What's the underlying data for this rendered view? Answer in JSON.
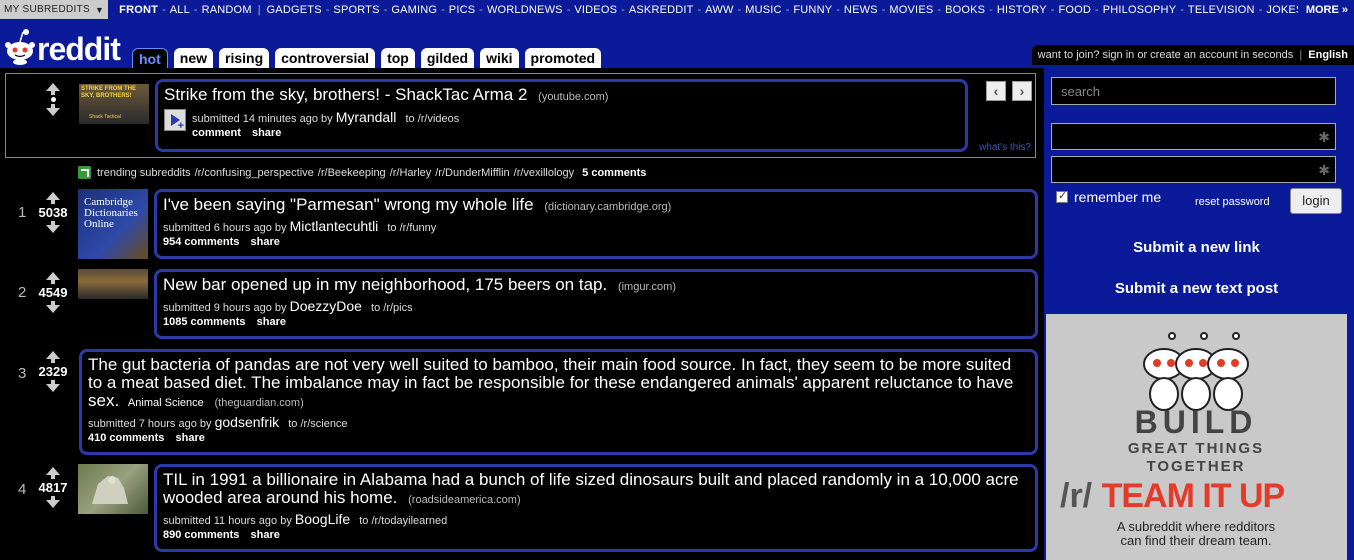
{
  "srbar": {
    "my_subreddits": "MY SUBREDDITS",
    "front": "FRONT",
    "all": "ALL",
    "random": "RANDOM",
    "links": [
      "GADGETS",
      "SPORTS",
      "GAMING",
      "PICS",
      "WORLDNEWS",
      "VIDEOS",
      "ASKREDDIT",
      "AWW",
      "MUSIC",
      "FUNNY",
      "NEWS",
      "MOVIES",
      "BOOKS",
      "HISTORY",
      "FOOD",
      "PHILOSOPHY",
      "TELEVISION",
      "JOKES"
    ],
    "more": "MORE »"
  },
  "header": {
    "logo_text": "reddit",
    "tabs": [
      "hot",
      "new",
      "rising",
      "controversial",
      "top",
      "gilded",
      "wiki",
      "promoted"
    ],
    "active_tab": "hot",
    "userbar_text": "want to join? sign in or create an account in seconds",
    "userbar_sep": "|",
    "language": "English"
  },
  "spotlight": {
    "title": "Strike from the sky, brothers! - ShackTac Arma 2",
    "domain": "(youtube.com)",
    "submitted": "submitted 14 minutes ago by",
    "author": "Myrandall",
    "to": "to /r/videos",
    "comment": "comment",
    "share": "share",
    "thumb_text1": "STRIKE FROM THE",
    "thumb_text2": "SKY, BROTHERS!",
    "thumb_text3": "Shack Tactical",
    "prev": "‹",
    "next": "›",
    "whats_this": "what's this?"
  },
  "trending": {
    "label": "trending subreddits",
    "subs": [
      "/r/confusing_perspective",
      "/r/Beekeeping",
      "/r/Harley",
      "/r/DunderMifflin",
      "/r/vexillology"
    ],
    "comments": "5 comments"
  },
  "posts": [
    {
      "rank": "1",
      "score": "5038",
      "title": "I've been saying \"Parmesan\" wrong my whole life",
      "domain": "(dictionary.cambridge.org)",
      "submitted": "submitted 6 hours ago by",
      "author": "Mictlantecuhtli",
      "to": "to /r/funny",
      "comments": "954 comments",
      "share": "share",
      "thumb_lines": [
        "Cambridge",
        "Dictionaries",
        "Online"
      ]
    },
    {
      "rank": "2",
      "score": "4549",
      "title": "New bar opened up in my neighborhood, 175 beers on tap.",
      "domain": "(imgur.com)",
      "submitted": "submitted 9 hours ago by",
      "author": "DoezzyDoe",
      "to": "to /r/pics",
      "comments": "1085 comments",
      "share": "share"
    },
    {
      "rank": "3",
      "score": "2329",
      "title": "The gut bacteria of pandas are not very well suited to bamboo, their main food source. In fact, they seem to be more suited to a meat based diet. The imbalance may in fact be responsible for these endangered animals' apparent reluctance to have sex.",
      "flair": "Animal Science",
      "domain": "(theguardian.com)",
      "submitted": "submitted 7 hours ago by",
      "author": "godsenfrik",
      "to": "to /r/science",
      "comments": "410 comments",
      "share": "share"
    },
    {
      "rank": "4",
      "score": "4817",
      "title": "TIL in 1991 a billionaire in Alabama had a bunch of life sized dinosaurs built and placed randomly in a 10,000 acre wooded area around his home.",
      "domain": "(roadsideamerica.com)",
      "submitted": "submitted 11 hours ago by",
      "author": "BoogLife",
      "to": "to /r/todayilearned",
      "comments": "890 comments",
      "share": "share"
    }
  ],
  "sidebar": {
    "search_placeholder": "search",
    "remember_me": "remember me",
    "reset_password": "reset password",
    "login": "login",
    "submit_link": "Submit a new link",
    "submit_text": "Submit a new text post",
    "ad": {
      "build": "BUILD",
      "great": "GREAT THINGS",
      "together": "TOGETHER",
      "r": "/r/",
      "team": "TEAM IT UP",
      "tag1": "A subreddit where redditors",
      "tag2": "can find their dream team."
    }
  },
  "colors": {
    "accent_blue": "#0a1a99",
    "entry_border": "#2b3aa8",
    "ad_red": "#e43a2a"
  }
}
